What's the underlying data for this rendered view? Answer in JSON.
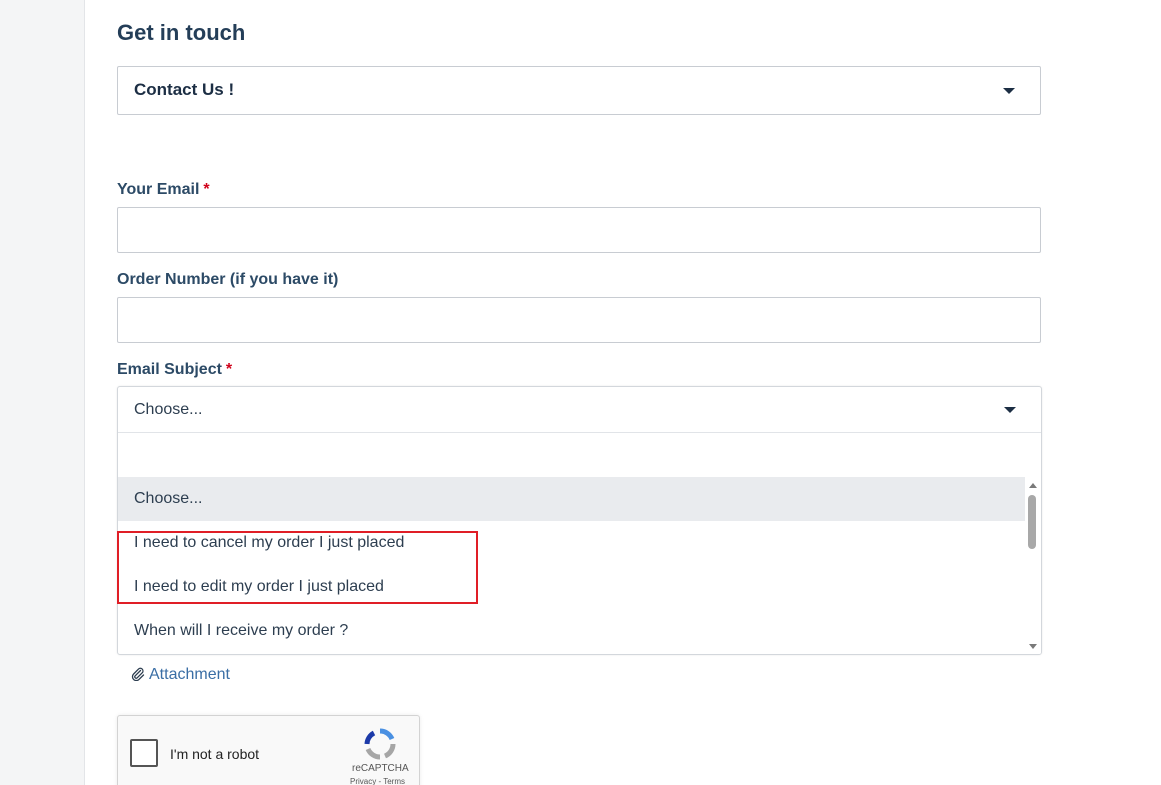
{
  "form": {
    "title": "Get in touch",
    "topic_select": {
      "value": "Contact Us !",
      "icon": "chevron-down-icon"
    },
    "email": {
      "label": "Your Email",
      "required_mark": "*",
      "value": ""
    },
    "order_number": {
      "label": "Order Number (if you have it)",
      "value": ""
    },
    "subject": {
      "label": "Email Subject",
      "required_mark": "*",
      "selected": "Choose...",
      "search_value": "",
      "options": [
        "Choose...",
        "I need to cancel my order I just placed",
        "I need to edit my order I just placed",
        "When will I receive my order ?"
      ],
      "highlighted_index": 0
    },
    "attachment": {
      "label": "Attachment",
      "icon": "paperclip-icon"
    },
    "recaptcha": {
      "checkbox_label": "I'm not a robot",
      "brand": "reCAPTCHA",
      "privacy": "Privacy",
      "separator": "-",
      "terms": "Terms",
      "checked": false
    }
  },
  "colors": {
    "heading": "#243e58",
    "required": "#d0021b",
    "link": "#3a6ea5",
    "annotation_box": "#e01e26",
    "option_highlight": "#e9ebee"
  }
}
